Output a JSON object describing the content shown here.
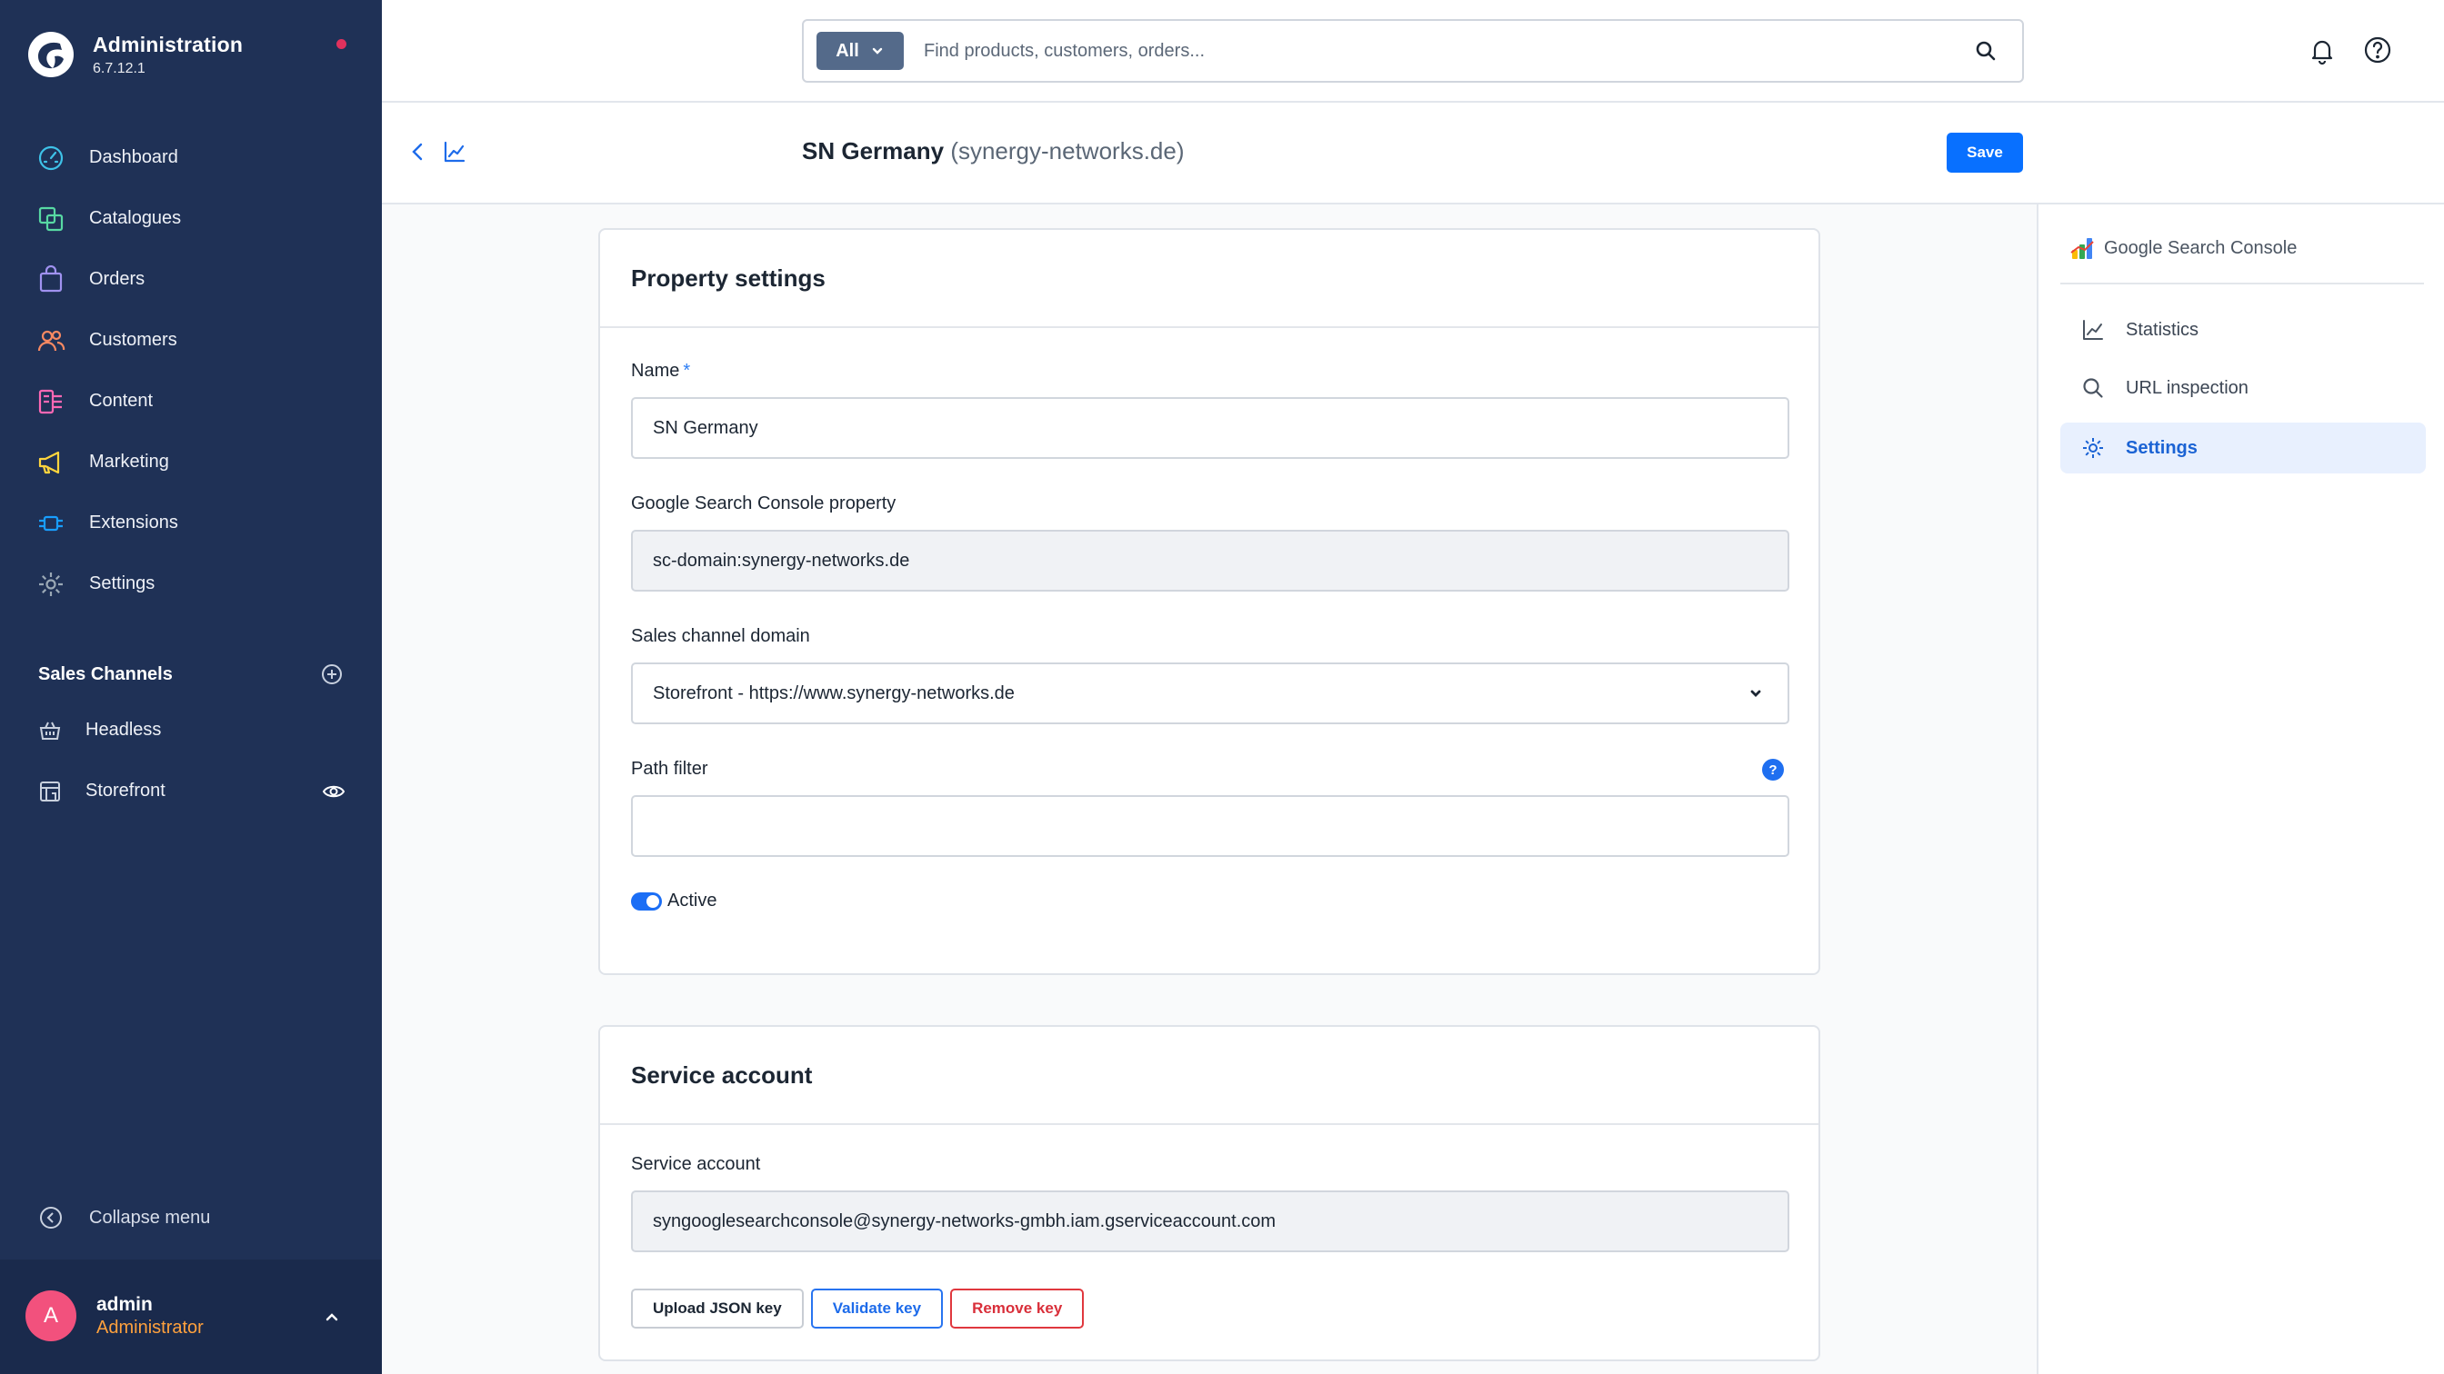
{
  "app": {
    "title": "Administration",
    "version": "6.7.12.1"
  },
  "nav": {
    "items": [
      {
        "label": "Dashboard",
        "icon": "gauge-icon"
      },
      {
        "label": "Catalogues",
        "icon": "catalogue-icon"
      },
      {
        "label": "Orders",
        "icon": "bag-icon"
      },
      {
        "label": "Customers",
        "icon": "users-icon"
      },
      {
        "label": "Content",
        "icon": "content-icon"
      },
      {
        "label": "Marketing",
        "icon": "megaphone-icon"
      },
      {
        "label": "Extensions",
        "icon": "plug-icon"
      },
      {
        "label": "Settings",
        "icon": "gear-icon"
      }
    ],
    "colors": {
      "dashboard": "#3ec2e8",
      "catalogues": "#57d9a3",
      "orders": "#a092f0",
      "customers": "#f88962",
      "content": "#ff68b4",
      "marketing": "#ffd53d",
      "extensions": "#189eff",
      "settings": "#9aa8b5"
    }
  },
  "sales_channels": {
    "title": "Sales Channels",
    "items": [
      {
        "label": "Headless"
      },
      {
        "label": "Storefront"
      }
    ]
  },
  "collapse_label": "Collapse menu",
  "user": {
    "initial": "A",
    "name": "admin",
    "role": "Administrator"
  },
  "search": {
    "type": "All",
    "placeholder": "Find products, customers, orders..."
  },
  "page": {
    "title": "SN Germany",
    "subtitle": "(synergy-networks.de)",
    "save_label": "Save"
  },
  "property_settings": {
    "title": "Property settings",
    "name_label": "Name",
    "required_mark": "*",
    "name_value": "SN Germany",
    "gsc_property_label": "Google Search Console property",
    "gsc_property_value": "sc-domain:synergy-networks.de",
    "domain_label": "Sales channel domain",
    "domain_value": "Storefront - https://www.synergy-networks.de",
    "path_filter_label": "Path filter",
    "path_filter_value": "",
    "help_mark": "?",
    "active_label": "Active"
  },
  "service_account": {
    "title": "Service account",
    "label": "Service account",
    "value": "syngooglesearchconsole@synergy-networks-gmbh.iam.gserviceaccount.com",
    "upload_label": "Upload JSON key",
    "validate_label": "Validate key",
    "remove_label": "Remove key"
  },
  "right_panel": {
    "brand": "Google Search Console",
    "items": [
      {
        "label": "Statistics",
        "icon": "chart-icon"
      },
      {
        "label": "URL inspection",
        "icon": "search-icon"
      },
      {
        "label": "Settings",
        "icon": "gear-icon",
        "active": true
      }
    ]
  }
}
